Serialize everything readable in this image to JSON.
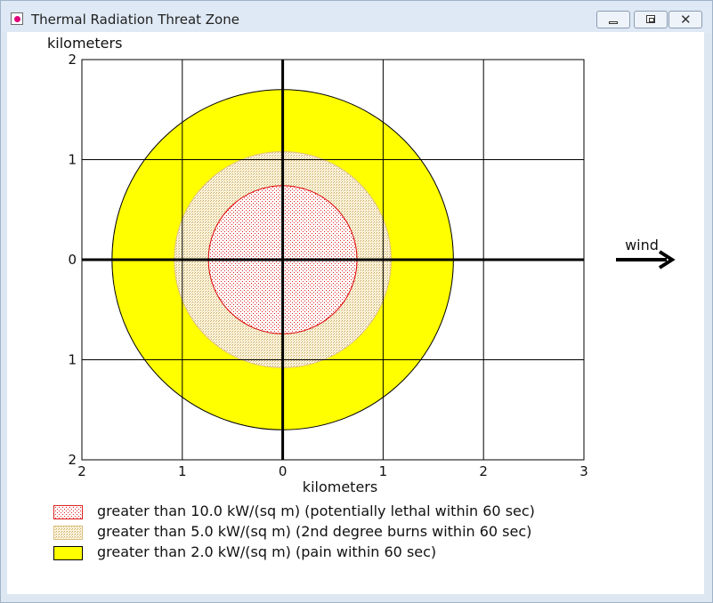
{
  "window": {
    "title": "Thermal Radiation Threat Zone",
    "icon": "app-icon",
    "controls": [
      "minimize-icon",
      "maximize-icon",
      "close-icon"
    ],
    "close_glyph": "✕"
  },
  "chart_data": {
    "type": "area",
    "title": "",
    "xlabel": "kilometers",
    "ylabel": "kilometers",
    "x_ticks": [
      "2",
      "1",
      "0",
      "1",
      "2",
      "3"
    ],
    "y_ticks": [
      "2",
      "1",
      "0",
      "1",
      "2"
    ],
    "xlim": [
      -2,
      3
    ],
    "ylim": [
      -2,
      2
    ],
    "grid": true,
    "wind_label": "wind",
    "wind_direction": "right",
    "zones": [
      {
        "name": "greater than 2.0 kW/(sq m) (pain within 60 sec)",
        "radius_km": 1.7,
        "color": "#ffff00",
        "pattern": "solid"
      },
      {
        "name": "greater than 5.0 kW/(sq m) (2nd degree burns within 60 sec)",
        "radius_km": 1.08,
        "color": "#f0dca0",
        "pattern": "dots"
      },
      {
        "name": "greater than 10.0 kW/(sq m) (potentially lethal within 60 sec)",
        "radius_km": 0.74,
        "color": "#ff0000",
        "pattern": "dots"
      }
    ]
  },
  "legend": [
    {
      "label": "greater than 10.0 kW/(sq m) (potentially lethal within 60 sec)",
      "pattern": "dots-red"
    },
    {
      "label": "greater than 5.0 kW/(sq m) (2nd degree burns within 60 sec)",
      "pattern": "dots-tan"
    },
    {
      "label": "greater than 2.0 kW/(sq m) (pain within 60 sec)",
      "pattern": "solid-yellow"
    }
  ]
}
